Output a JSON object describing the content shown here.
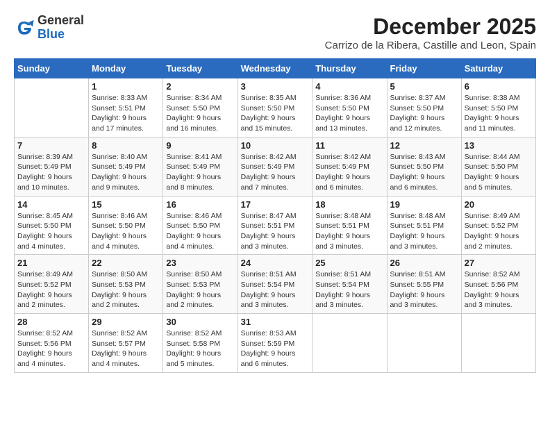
{
  "header": {
    "logo_general": "General",
    "logo_blue": "Blue",
    "month_title": "December 2025",
    "location": "Carrizo de la Ribera, Castille and Leon, Spain"
  },
  "calendar": {
    "weekdays": [
      "Sunday",
      "Monday",
      "Tuesday",
      "Wednesday",
      "Thursday",
      "Friday",
      "Saturday"
    ],
    "weeks": [
      [
        {
          "day": "",
          "info": ""
        },
        {
          "day": "1",
          "info": "Sunrise: 8:33 AM\nSunset: 5:51 PM\nDaylight: 9 hours\nand 17 minutes."
        },
        {
          "day": "2",
          "info": "Sunrise: 8:34 AM\nSunset: 5:50 PM\nDaylight: 9 hours\nand 16 minutes."
        },
        {
          "day": "3",
          "info": "Sunrise: 8:35 AM\nSunset: 5:50 PM\nDaylight: 9 hours\nand 15 minutes."
        },
        {
          "day": "4",
          "info": "Sunrise: 8:36 AM\nSunset: 5:50 PM\nDaylight: 9 hours\nand 13 minutes."
        },
        {
          "day": "5",
          "info": "Sunrise: 8:37 AM\nSunset: 5:50 PM\nDaylight: 9 hours\nand 12 minutes."
        },
        {
          "day": "6",
          "info": "Sunrise: 8:38 AM\nSunset: 5:50 PM\nDaylight: 9 hours\nand 11 minutes."
        }
      ],
      [
        {
          "day": "7",
          "info": "Sunrise: 8:39 AM\nSunset: 5:49 PM\nDaylight: 9 hours\nand 10 minutes."
        },
        {
          "day": "8",
          "info": "Sunrise: 8:40 AM\nSunset: 5:49 PM\nDaylight: 9 hours\nand 9 minutes."
        },
        {
          "day": "9",
          "info": "Sunrise: 8:41 AM\nSunset: 5:49 PM\nDaylight: 9 hours\nand 8 minutes."
        },
        {
          "day": "10",
          "info": "Sunrise: 8:42 AM\nSunset: 5:49 PM\nDaylight: 9 hours\nand 7 minutes."
        },
        {
          "day": "11",
          "info": "Sunrise: 8:42 AM\nSunset: 5:49 PM\nDaylight: 9 hours\nand 6 minutes."
        },
        {
          "day": "12",
          "info": "Sunrise: 8:43 AM\nSunset: 5:50 PM\nDaylight: 9 hours\nand 6 minutes."
        },
        {
          "day": "13",
          "info": "Sunrise: 8:44 AM\nSunset: 5:50 PM\nDaylight: 9 hours\nand 5 minutes."
        }
      ],
      [
        {
          "day": "14",
          "info": "Sunrise: 8:45 AM\nSunset: 5:50 PM\nDaylight: 9 hours\nand 4 minutes."
        },
        {
          "day": "15",
          "info": "Sunrise: 8:46 AM\nSunset: 5:50 PM\nDaylight: 9 hours\nand 4 minutes."
        },
        {
          "day": "16",
          "info": "Sunrise: 8:46 AM\nSunset: 5:50 PM\nDaylight: 9 hours\nand 4 minutes."
        },
        {
          "day": "17",
          "info": "Sunrise: 8:47 AM\nSunset: 5:51 PM\nDaylight: 9 hours\nand 3 minutes."
        },
        {
          "day": "18",
          "info": "Sunrise: 8:48 AM\nSunset: 5:51 PM\nDaylight: 9 hours\nand 3 minutes."
        },
        {
          "day": "19",
          "info": "Sunrise: 8:48 AM\nSunset: 5:51 PM\nDaylight: 9 hours\nand 3 minutes."
        },
        {
          "day": "20",
          "info": "Sunrise: 8:49 AM\nSunset: 5:52 PM\nDaylight: 9 hours\nand 2 minutes."
        }
      ],
      [
        {
          "day": "21",
          "info": "Sunrise: 8:49 AM\nSunset: 5:52 PM\nDaylight: 9 hours\nand 2 minutes."
        },
        {
          "day": "22",
          "info": "Sunrise: 8:50 AM\nSunset: 5:53 PM\nDaylight: 9 hours\nand 2 minutes."
        },
        {
          "day": "23",
          "info": "Sunrise: 8:50 AM\nSunset: 5:53 PM\nDaylight: 9 hours\nand 2 minutes."
        },
        {
          "day": "24",
          "info": "Sunrise: 8:51 AM\nSunset: 5:54 PM\nDaylight: 9 hours\nand 3 minutes."
        },
        {
          "day": "25",
          "info": "Sunrise: 8:51 AM\nSunset: 5:54 PM\nDaylight: 9 hours\nand 3 minutes."
        },
        {
          "day": "26",
          "info": "Sunrise: 8:51 AM\nSunset: 5:55 PM\nDaylight: 9 hours\nand 3 minutes."
        },
        {
          "day": "27",
          "info": "Sunrise: 8:52 AM\nSunset: 5:56 PM\nDaylight: 9 hours\nand 3 minutes."
        }
      ],
      [
        {
          "day": "28",
          "info": "Sunrise: 8:52 AM\nSunset: 5:56 PM\nDaylight: 9 hours\nand 4 minutes."
        },
        {
          "day": "29",
          "info": "Sunrise: 8:52 AM\nSunset: 5:57 PM\nDaylight: 9 hours\nand 4 minutes."
        },
        {
          "day": "30",
          "info": "Sunrise: 8:52 AM\nSunset: 5:58 PM\nDaylight: 9 hours\nand 5 minutes."
        },
        {
          "day": "31",
          "info": "Sunrise: 8:53 AM\nSunset: 5:59 PM\nDaylight: 9 hours\nand 6 minutes."
        },
        {
          "day": "",
          "info": ""
        },
        {
          "day": "",
          "info": ""
        },
        {
          "day": "",
          "info": ""
        }
      ]
    ]
  }
}
